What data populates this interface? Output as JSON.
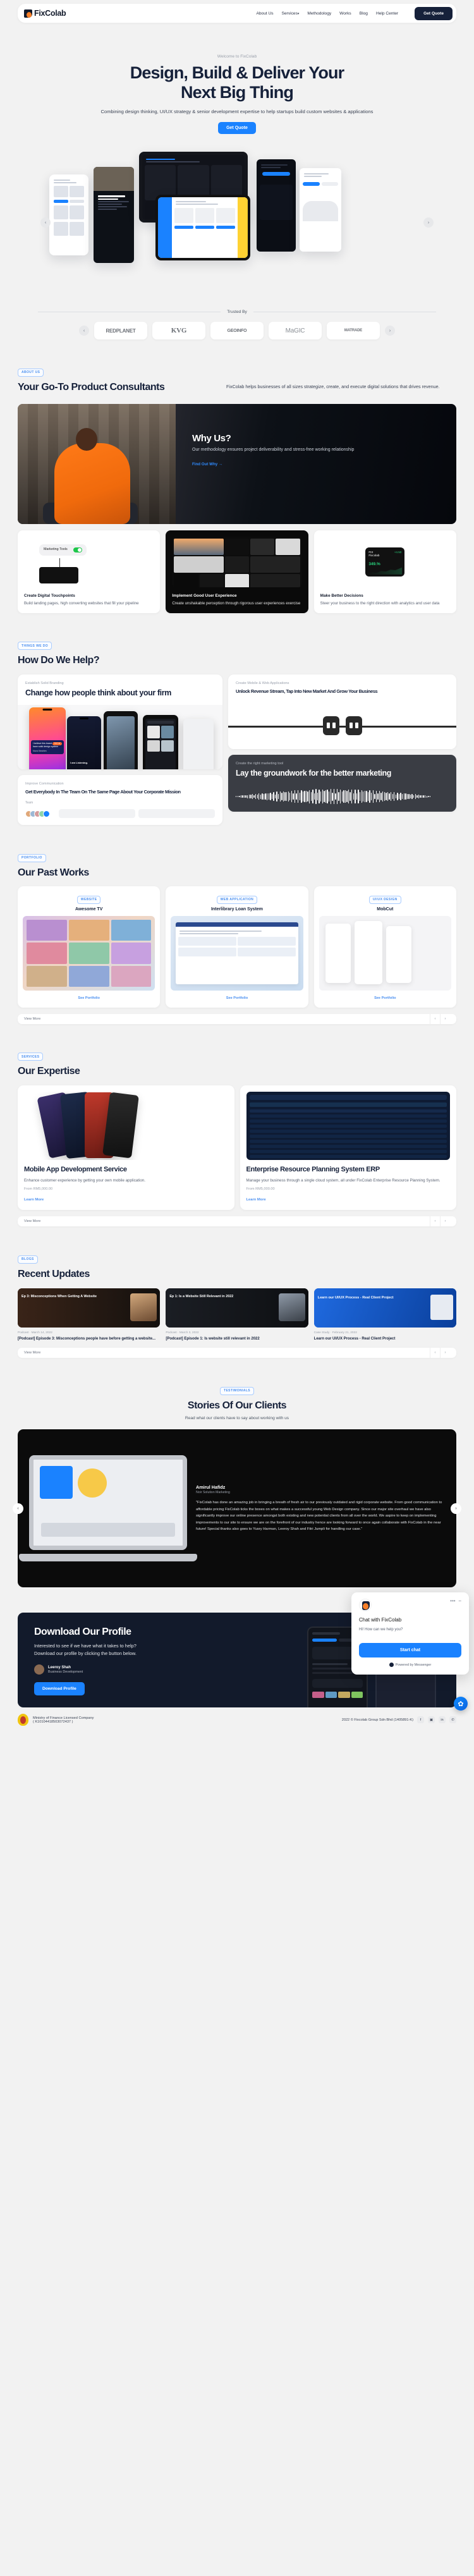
{
  "nav": {
    "brand": "FixColab",
    "links": [
      {
        "label": "About Us"
      },
      {
        "label": "Services",
        "caret": "▾"
      },
      {
        "label": "Methodology"
      },
      {
        "label": "Works"
      },
      {
        "label": "Blog"
      },
      {
        "label": "Help Center"
      }
    ],
    "cta": "Get Quote"
  },
  "hero": {
    "eyebrow": "Welcome to FixColab",
    "title_line1": "Design, Build & Deliver Your",
    "title_line2": "Next Big Thing",
    "subtitle": "Combining design thinking, UI/UX strategy & senior development expertise to help startups build custom websites & applications",
    "cta": "Get Quote",
    "prev": "‹",
    "next": "›"
  },
  "trusted": {
    "label": "Trusted By",
    "logos": [
      "REDPLANET",
      "KVG",
      "GEOINFO",
      "MaGIC",
      "MATRADE"
    ],
    "prev": "‹",
    "next": "›"
  },
  "about": {
    "tag": "ABOUT US",
    "heading": "Your Go-To Product Consultants",
    "lead": "FixColab helps businesses of all sizes strategize, create, and execute digital solutions that drives revenue.",
    "whyus": {
      "title": "Why Us?",
      "text": "Our methodology ensures project deliverability and stress-free working relationship",
      "link": "Find Out Why  →"
    },
    "cards": [
      {
        "title": "Create Digital Touchpoints",
        "text": "Build landing pages, high converting websites that fill your pipeline",
        "toggle_label": "Marketing Tools"
      },
      {
        "title": "Implement Good User Experience",
        "text": "Create unshakable perception through rigorous user experiences exercise"
      },
      {
        "title": "Make Better Decisions",
        "text": "Steer your business to the right direction with analytics and user data",
        "ticker": "FIX",
        "ticker_name": "Fixcolab",
        "change": "+4.50",
        "value": "349.%"
      }
    ]
  },
  "help": {
    "tag": "THINGS WE DO",
    "heading": "How Do We Help?",
    "cards": [
      {
        "kicker": "Establish Solid Branding",
        "title": "Change how people think about your firm",
        "phone_toast": "I believe this brand have solid design system",
        "phone_toast_author": "Nurul Ibrahim",
        "phone_toast_badge": "5.0 ★",
        "phone_text": "I am Listening."
      },
      {
        "kicker": "Create Mobile & Web Applications",
        "title": "Unlock Revenue Stream, Tap Into New Market And Grow Your Business"
      },
      {
        "kicker": "Create the right marketing tool",
        "title": "Lay the groundwork for the better marketing"
      },
      {
        "kicker": "Improve Communication",
        "title": "Get Everybody In The Team On The Same Page About Your Corporate Mission",
        "team_label": "Team"
      }
    ]
  },
  "portfolio": {
    "tag": "PORTFOLIO",
    "heading": "Our Past Works",
    "view_more": "View More",
    "prev": "‹",
    "next": "›",
    "items": [
      {
        "tag": "WEBSITE",
        "title": "Awesome TV",
        "link": "See Portfolio"
      },
      {
        "tag": "WEB APPLICATION",
        "title": "Interlibrary Loan System",
        "link": "See Portfolio"
      },
      {
        "tag": "UI/UX DESIGN",
        "title": "MobCut",
        "link": "See Portfolio"
      }
    ]
  },
  "expertise": {
    "tag": "SERVICES",
    "heading": "Our Expertise",
    "view_more": "View More",
    "prev": "‹",
    "next": "›",
    "items": [
      {
        "title": "Mobile App Development Service",
        "text": "Enhance customer experience by getting your own mobile application.",
        "sub": "From RM5,000.00",
        "link": "Learn More"
      },
      {
        "title": "Enterprise Resource Planning System ERP",
        "text": "Manage your business through a single cloud system, all under FixColab Enterprise Resource Planning System.",
        "sub": "From RM5,000.00",
        "link": "Learn More"
      }
    ]
  },
  "updates": {
    "tag": "BLOGS",
    "heading": "Recent Updates",
    "view_more": "View More",
    "prev": "‹",
    "next": "›",
    "items": [
      {
        "thumb_title": "Ep 3: Misconceptions When Getting A Website",
        "meta": "Podcast · March 14, 2022",
        "title": "[Podcast] Episode 3: Misconceptions people have before getting a website..."
      },
      {
        "thumb_title": "Ep 1: Is a Website Still Relevant in 2022",
        "meta": "Podcast · March 3, 2022",
        "title": "[Podcast] Episode 1: Is website still relevant in 2022"
      },
      {
        "thumb_title": "Learn our UI/UX Process - Real Client Project",
        "meta": "Case Study · February 21, 2022",
        "title": "Learn our UI/UX Process - Real Client Project"
      }
    ]
  },
  "testimonials": {
    "tag": "TESTIMONIALS",
    "heading": "Stories Of Our Clients",
    "subheading": "Read what our clients have to say about working with us",
    "prev": "‹",
    "next": "›",
    "quote": {
      "name": "Amirul Hafidz",
      "role": "Noir Solution Marketing",
      "text": "\"FixColab has done an amazing job in bringing a breath of fresh air to our previously outdated and rigid corporate website. From good communication to affordable pricing FixColab ticks the boxes on what makes a successful young Web Design company. Since our major site overhaul we have also significantly improve our online presence amongst both existing and new potential clients from all over the world. We aspire to keep on implementing improvements to our site to ensure we are on the forefront of our industry hence are looking forward to once again collaborate with FixColab in the near future! Special thanks also goes to Yusry Harman, Leeroy Shah and Fitri Jumpli for handling our case.\""
    }
  },
  "cta": {
    "heading": "Download Our Profile",
    "line1": "Interested to see if we have what it takes to help?",
    "line2": "Download our profile by clicking the button below.",
    "person_name": "Leeroy Shah",
    "person_role": "Business Development",
    "button": "Download Profile"
  },
  "footer": {
    "license_line1": "Ministry of Finance Licensed Company",
    "license_line2": "( K10104418503072437 )",
    "copyright": "2022 © Fixcolab Group Sdn Bhd (1405891-K)",
    "socials": [
      "f",
      "▣",
      "in",
      "✆"
    ]
  },
  "chat": {
    "title": "Chat with FixColab",
    "message": "Hi! How can we help you?",
    "button": "Start chat",
    "powered": "Powered by Messenger",
    "menu_icon": "•••",
    "minimize_icon": "–",
    "fab_icon": "✿"
  }
}
